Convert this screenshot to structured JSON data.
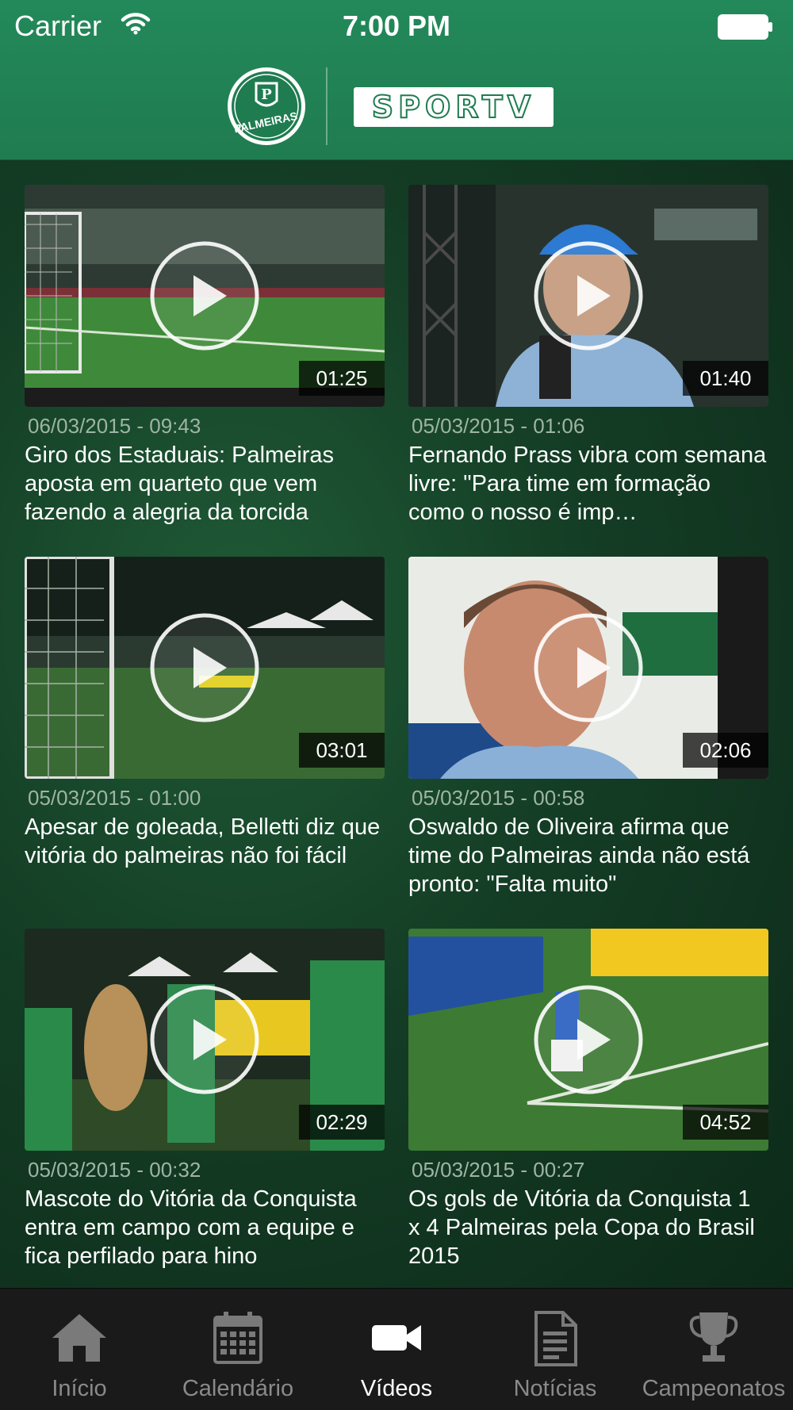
{
  "status_bar": {
    "carrier": "Carrier",
    "time": "7:00 PM"
  },
  "header": {
    "club_logo_text": "PALMEIRAS",
    "partner_logo_text": "SPORTV"
  },
  "videos": [
    {
      "date": "06/03/2015 - 09:43",
      "duration": "01:25",
      "title": "Giro dos Estaduais: Palmeiras aposta em quarteto que vem fazendo a alegria da torcida"
    },
    {
      "date": "05/03/2015 - 01:06",
      "duration": "01:40",
      "title": "Fernando Prass vibra com semana livre: \"Para time em formação como o nosso é imp…"
    },
    {
      "date": "05/03/2015 - 01:00",
      "duration": "03:01",
      "title": "Apesar de goleada, Belletti diz que vitória do palmeiras não foi fácil"
    },
    {
      "date": "05/03/2015 - 00:58",
      "duration": "02:06",
      "title": "Oswaldo de Oliveira afirma que time do Palmeiras ainda não está pronto: \"Falta muito\""
    },
    {
      "date": "05/03/2015 - 00:32",
      "duration": "02:29",
      "title": "Mascote do Vitória da Conquista entra em campo com a equipe e fica perfilado para hino"
    },
    {
      "date": "05/03/2015 - 00:27",
      "duration": "04:52",
      "title": "Os gols de Vitória da Conquista 1 x 4 Palmeiras pela Copa do Brasil 2015"
    }
  ],
  "tabs": [
    {
      "label": "Início",
      "icon": "home-icon",
      "active": false
    },
    {
      "label": "Calendário",
      "icon": "calendar-icon",
      "active": false
    },
    {
      "label": "Vídeos",
      "icon": "video-camera-icon",
      "active": true
    },
    {
      "label": "Notícias",
      "icon": "news-icon",
      "active": false
    },
    {
      "label": "Campeonatos",
      "icon": "trophy-icon",
      "active": false
    }
  ],
  "colors": {
    "header_green": "#23895a",
    "active_tab": "#ffffff",
    "inactive_tab": "#8a8a8a"
  }
}
